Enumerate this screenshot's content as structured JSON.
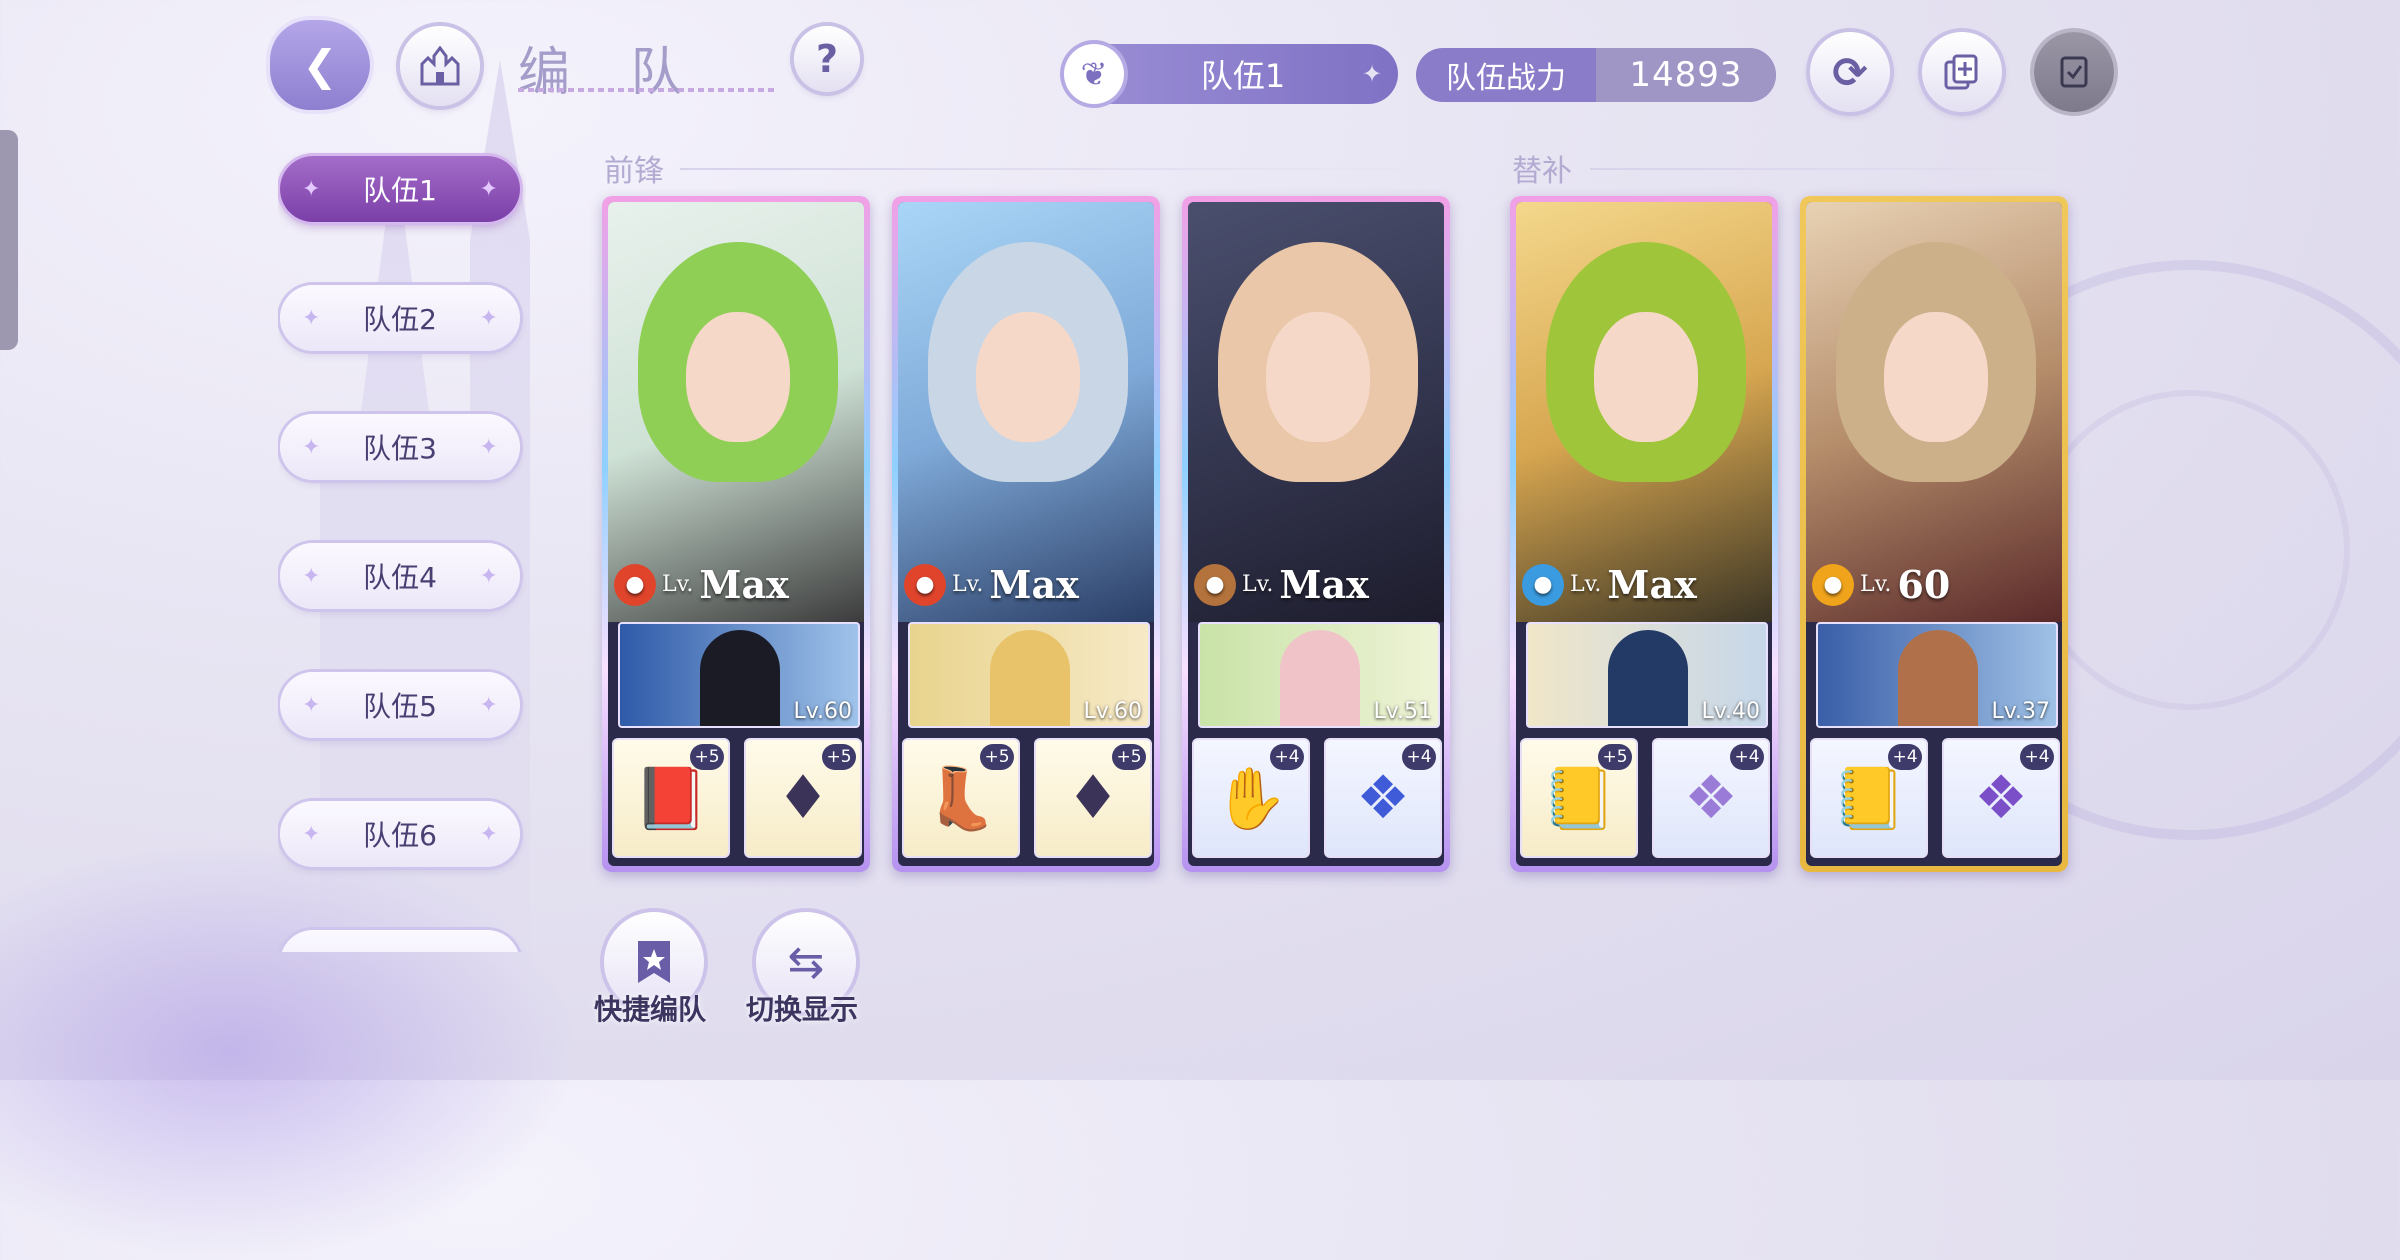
{
  "header": {
    "title": "编 队",
    "current_team": "队伍1",
    "power_label": "队伍战力",
    "power_value": "14893"
  },
  "icons": {
    "back": "back-arrow-icon",
    "home": "castle-home-icon",
    "help": "question-icon",
    "feather": "feather-icon",
    "refresh": "refresh-icon",
    "copy": "copy-add-icon",
    "confirm": "check-clipboard-icon",
    "quick": "bookmark-star-icon",
    "switch": "swap-arrows-icon"
  },
  "teams": [
    "队伍1",
    "队伍2",
    "队伍3",
    "队伍4",
    "队伍5",
    "队伍6"
  ],
  "sections": {
    "front": "前锋",
    "sub": "替补"
  },
  "level_prefix": "Lv.",
  "cards": [
    {
      "level": "Max",
      "element": "red",
      "partner_level": "Lv.60",
      "equip": [
        {
          "plus": "+5",
          "icon": "book"
        },
        {
          "plus": "+5",
          "icon": "earring"
        }
      ]
    },
    {
      "level": "Max",
      "element": "red",
      "partner_level": "Lv.60",
      "equip": [
        {
          "plus": "+5",
          "icon": "boot"
        },
        {
          "plus": "+5",
          "icon": "earring"
        }
      ]
    },
    {
      "level": "Max",
      "element": "brown",
      "partner_level": "Lv.51",
      "equip": [
        {
          "plus": "+4",
          "icon": "glove"
        },
        {
          "plus": "+4",
          "icon": "earring-blue"
        }
      ]
    },
    {
      "level": "Max",
      "element": "blue",
      "partner_level": "Lv.40",
      "equip": [
        {
          "plus": "+5",
          "icon": "book"
        },
        {
          "plus": "+4",
          "icon": "earring-blue"
        }
      ]
    },
    {
      "level": "60",
      "element": "gold",
      "partner_level": "Lv.37",
      "equip": [
        {
          "plus": "+4",
          "icon": "book"
        },
        {
          "plus": "+4",
          "icon": "earring-blue"
        }
      ]
    }
  ],
  "bottom": {
    "quick_label": "快捷编队",
    "switch_label": "切换显示"
  },
  "colors": {
    "accent": "#7b3fa8",
    "power_bg": "#8a7cc8",
    "gold_frame": "#e8b840"
  }
}
